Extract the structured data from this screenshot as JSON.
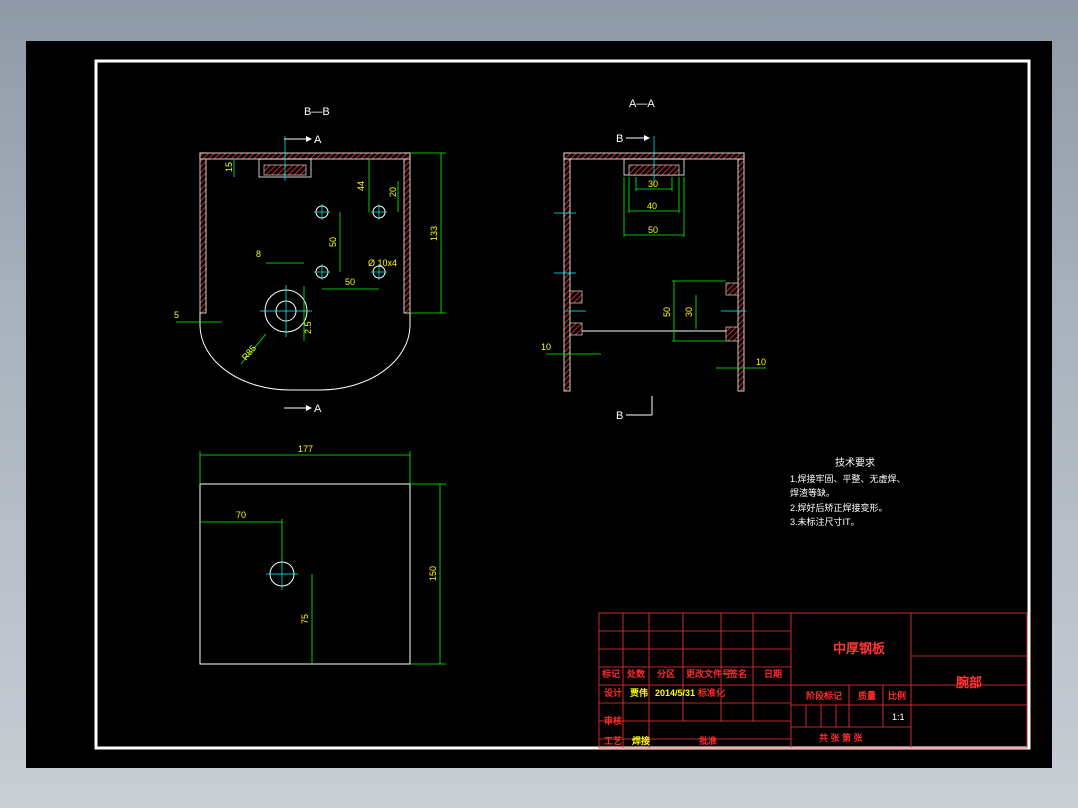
{
  "views": {
    "section_bb": {
      "title": "B—B",
      "cut_top": "A",
      "cut_bottom": "A"
    },
    "section_aa": {
      "title": "A—A",
      "cut_top": "B",
      "cut_bottom": "B"
    }
  },
  "dimensions": {
    "bb_15": "15",
    "bb_44": "44",
    "bb_20": "20",
    "bb_50v": "50",
    "bb_8": "8",
    "bb_hole": "Ø 10x4",
    "bb_50h": "50",
    "bb_5": "5",
    "bb_r": "R85",
    "bb_25": "2.5",
    "bb_133": "133",
    "aa_30": "30",
    "aa_40": "40",
    "aa_50": "50",
    "aa_50v": "50",
    "aa_30v": "30",
    "aa_10l": "10",
    "aa_10r": "10",
    "bot_177": "177",
    "bot_70": "70",
    "bot_75": "75",
    "bot_150": "150"
  },
  "notes": {
    "title": "技术要求",
    "lines": [
      "1.焊接牢固、平整、无虚焊、",
      "焊渣等缺。",
      "2.焊好后矫正焊接变形。",
      "3.未标注尺寸IT。"
    ]
  },
  "title_block": {
    "part_name": "中厚钢板",
    "drawing_name": "腕部",
    "headers": [
      "标记",
      "处数",
      "分区",
      "更改文件号",
      "签名",
      "日期"
    ],
    "design_label": "设计",
    "designer": "贾伟",
    "date": "2014/5/31",
    "standard_label": "标准化",
    "review_label": "审核",
    "process_label": "工艺",
    "process_value": "焊接",
    "approve_label": "批准",
    "stage_label": "阶段标记",
    "mass_label": "质量",
    "scale_label": "比例",
    "scale_value": "1:1",
    "sheet_label": "共  张   第  张"
  },
  "colors": {
    "background": "#000000",
    "border": "#ffffff",
    "part": "#ffffff",
    "dimension": "#00ff00",
    "text": "#ffff00",
    "hatch": "#ff3333",
    "grid": "#ff3333",
    "center": "#00ffff"
  }
}
